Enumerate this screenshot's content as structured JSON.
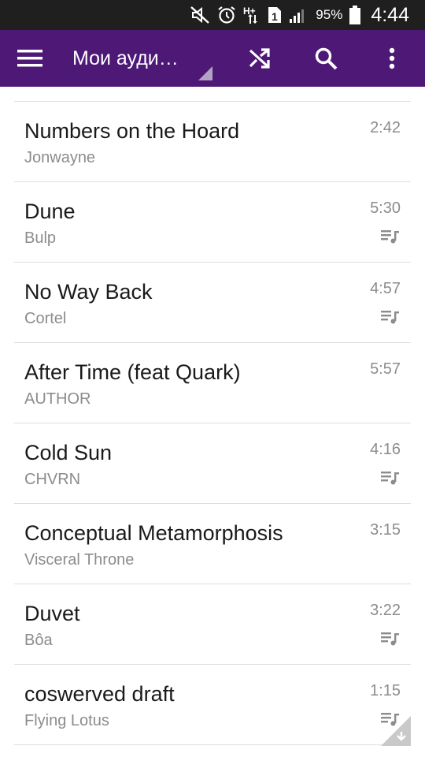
{
  "status_bar": {
    "icons": [
      "mute-icon",
      "alarm-icon",
      "hplus-data-icon",
      "sim1-icon",
      "signal-icon",
      "battery-icon"
    ],
    "network_label": "H+",
    "sim_label": "1",
    "battery_percent": "95%",
    "time": "4:44"
  },
  "app_bar": {
    "title": "Мои ауди…",
    "color": "#4e1877",
    "icons": [
      "menu-icon",
      "shuffle-icon",
      "search-icon",
      "more-vert-icon"
    ]
  },
  "tracks": [
    {
      "title": "Numbers on the Hoard",
      "artist": "Jonwayne",
      "duration": "2:42",
      "in_playlist": false
    },
    {
      "title": "Dune",
      "artist": "Bulp",
      "duration": "5:30",
      "in_playlist": true
    },
    {
      "title": "No Way Back",
      "artist": "Cortel",
      "duration": "4:57",
      "in_playlist": true
    },
    {
      "title": "After Time (feat Quark)",
      "artist": "AUTHOR",
      "duration": "5:57",
      "in_playlist": false
    },
    {
      "title": "Cold Sun",
      "artist": "CHVRN",
      "duration": "4:16",
      "in_playlist": true
    },
    {
      "title": "Conceptual Metamorphosis",
      "artist": "Visceral Throne",
      "duration": "3:15",
      "in_playlist": false
    },
    {
      "title": "Duvet",
      "artist": "Bôa",
      "duration": "3:22",
      "in_playlist": true
    },
    {
      "title": "coswerved draft",
      "artist": "Flying Lotus",
      "duration": "1:15",
      "in_playlist": true
    }
  ]
}
